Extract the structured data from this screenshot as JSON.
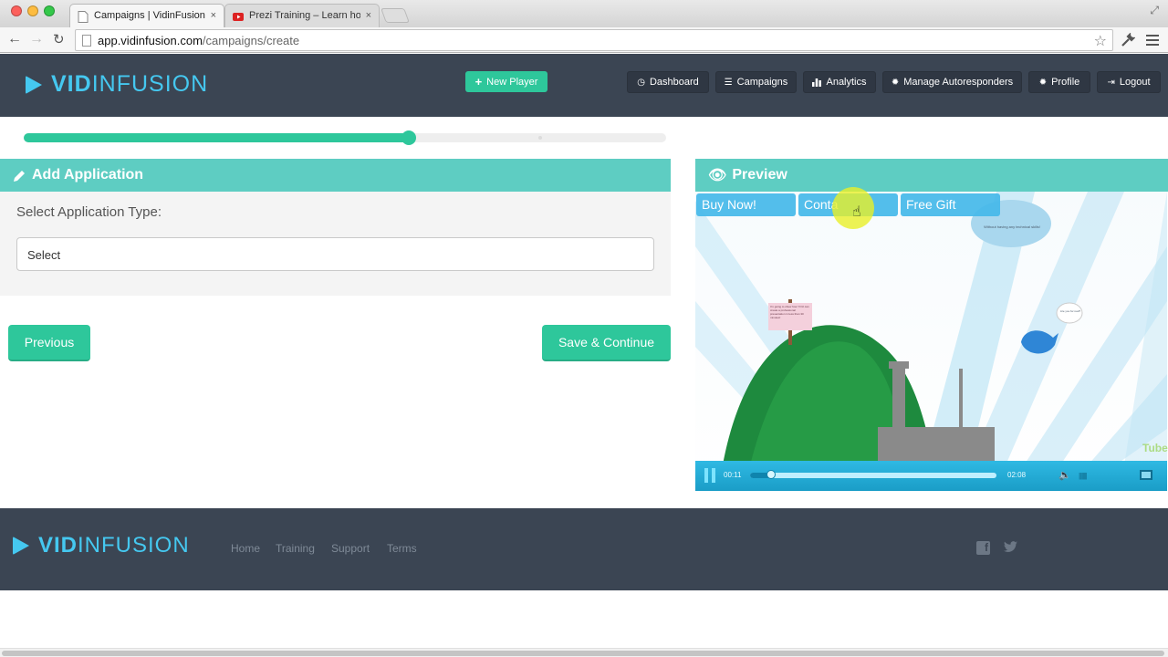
{
  "browser": {
    "tabs": [
      {
        "title": "Campaigns | VidinFusion",
        "close": "×"
      },
      {
        "title": "Prezi Training – Learn how",
        "close": "×"
      }
    ],
    "url_domain": "app.vidinfusion.com",
    "url_path": "/campaigns/create",
    "icons": [
      "back-icon",
      "forward-icon",
      "reload-icon",
      "star-icon",
      "wrench-icon",
      "menu-icon"
    ]
  },
  "header": {
    "logo_bold": "VID",
    "logo_light": "INFUSION",
    "new_player_label": "New Player",
    "nav": [
      {
        "icon": "clock-icon",
        "label": "Dashboard"
      },
      {
        "icon": "list-icon",
        "label": "Campaigns"
      },
      {
        "icon": "bar-chart-icon",
        "label": "Analytics"
      },
      {
        "icon": "gear-icon",
        "label": "Manage Autoresponders"
      },
      {
        "icon": "gear-icon",
        "label": "Profile"
      },
      {
        "icon": "logout-icon",
        "label": "Logout"
      }
    ]
  },
  "progress": {
    "fraction": 0.6
  },
  "add_application": {
    "title": "Add Application",
    "select_label": "Select Application Type:",
    "select_value": "Select"
  },
  "actions": {
    "previous_label": "Previous",
    "save_continue_label": "Save & Continue"
  },
  "preview": {
    "title": "Preview",
    "overlay_buttons": [
      "Buy Now!",
      "Conta",
      "Free Gift"
    ],
    "cloud_text": "Without having any technical skills!",
    "bubble_text": "Are you for real?",
    "sign_text": "I'm going to show how YOU can create a professional presentation in less than 30 minutes!",
    "current_time": "00:11",
    "duration": "02:08",
    "played_fraction": 0.086,
    "watermark": "Tube"
  },
  "footer": {
    "logo_bold": "VID",
    "logo_light": "INFUSION",
    "links": [
      "Home",
      "Training",
      "Support",
      "Terms"
    ],
    "social": [
      "facebook-icon",
      "twitter-icon"
    ]
  },
  "colors": {
    "header_bg": "#3b4553",
    "accent_green": "#2ec79b",
    "panel_teal": "#5ecdc2",
    "logo_blue": "#45c8f0"
  }
}
